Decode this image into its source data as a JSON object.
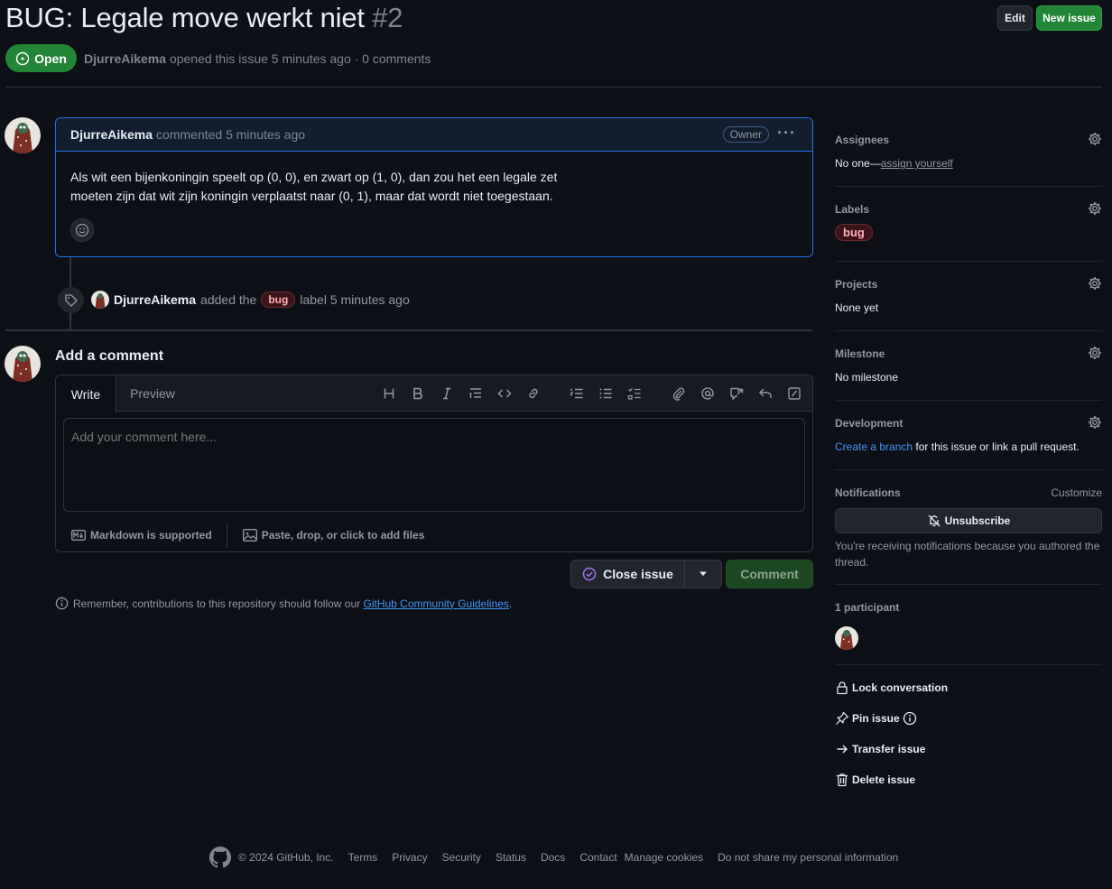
{
  "issue": {
    "title": "BUG: Legale move werkt niet",
    "number": "#2",
    "state": "Open",
    "author": "DjurreAikema",
    "meta_text": "opened this issue 5 minutes ago · 0 comments"
  },
  "header_buttons": {
    "edit": "Edit",
    "new_issue": "New issue"
  },
  "comment": {
    "author": "DjurreAikema",
    "time": "commented 5 minutes ago",
    "badge": "Owner",
    "body_line1": "Als wit een bijenkoningin speelt op (0, 0), en zwart op (1, 0), dan zou het een legale zet",
    "body_line2": "moeten zijn dat wit zijn koningin verplaatst naar (0, 1), maar dat wordt niet toegestaan."
  },
  "event": {
    "author": "DjurreAikema",
    "text_before": "added the",
    "label": "bug",
    "text_after": "label 5 minutes ago"
  },
  "composer": {
    "title": "Add a comment",
    "tab_write": "Write",
    "tab_preview": "Preview",
    "placeholder": "Add your comment here...",
    "markdown": "Markdown is supported",
    "files": "Paste, drop, or click to add files",
    "close_issue": "Close issue",
    "comment_button": "Comment",
    "remember_text": "Remember, contributions to this repository should follow our",
    "guidelines_link": "GitHub Community Guidelines",
    "remember_end": "."
  },
  "sidebar": {
    "assignees_title": "Assignees",
    "assignees_none": "No one—",
    "assign_yourself": "assign yourself",
    "labels_title": "Labels",
    "label_bug": "bug",
    "projects_title": "Projects",
    "projects_value": "None yet",
    "milestone_title": "Milestone",
    "milestone_value": "No milestone",
    "development_title": "Development",
    "create_branch": "Create a branch",
    "development_rest": "for this issue or link a pull request.",
    "notifications_title": "Notifications",
    "customize": "Customize",
    "unsubscribe": "Unsubscribe",
    "notif_reason": "You're receiving notifications because you authored the thread.",
    "participants": "1 participant",
    "lock": "Lock conversation",
    "pin": "Pin issue",
    "transfer": "Transfer issue",
    "delete": "Delete issue"
  },
  "footer": {
    "copyright": "© 2024 GitHub, Inc.",
    "links": [
      "Terms",
      "Privacy",
      "Security",
      "Status",
      "Docs",
      "Contact",
      "Manage cookies",
      "Do not share my personal information"
    ]
  },
  "colors": {
    "background": "#0d1117",
    "open_green": "#238636",
    "link_blue": "#4493f8",
    "comment_border": "#1f6feb",
    "label_bug_text": "#ffb0b6"
  }
}
